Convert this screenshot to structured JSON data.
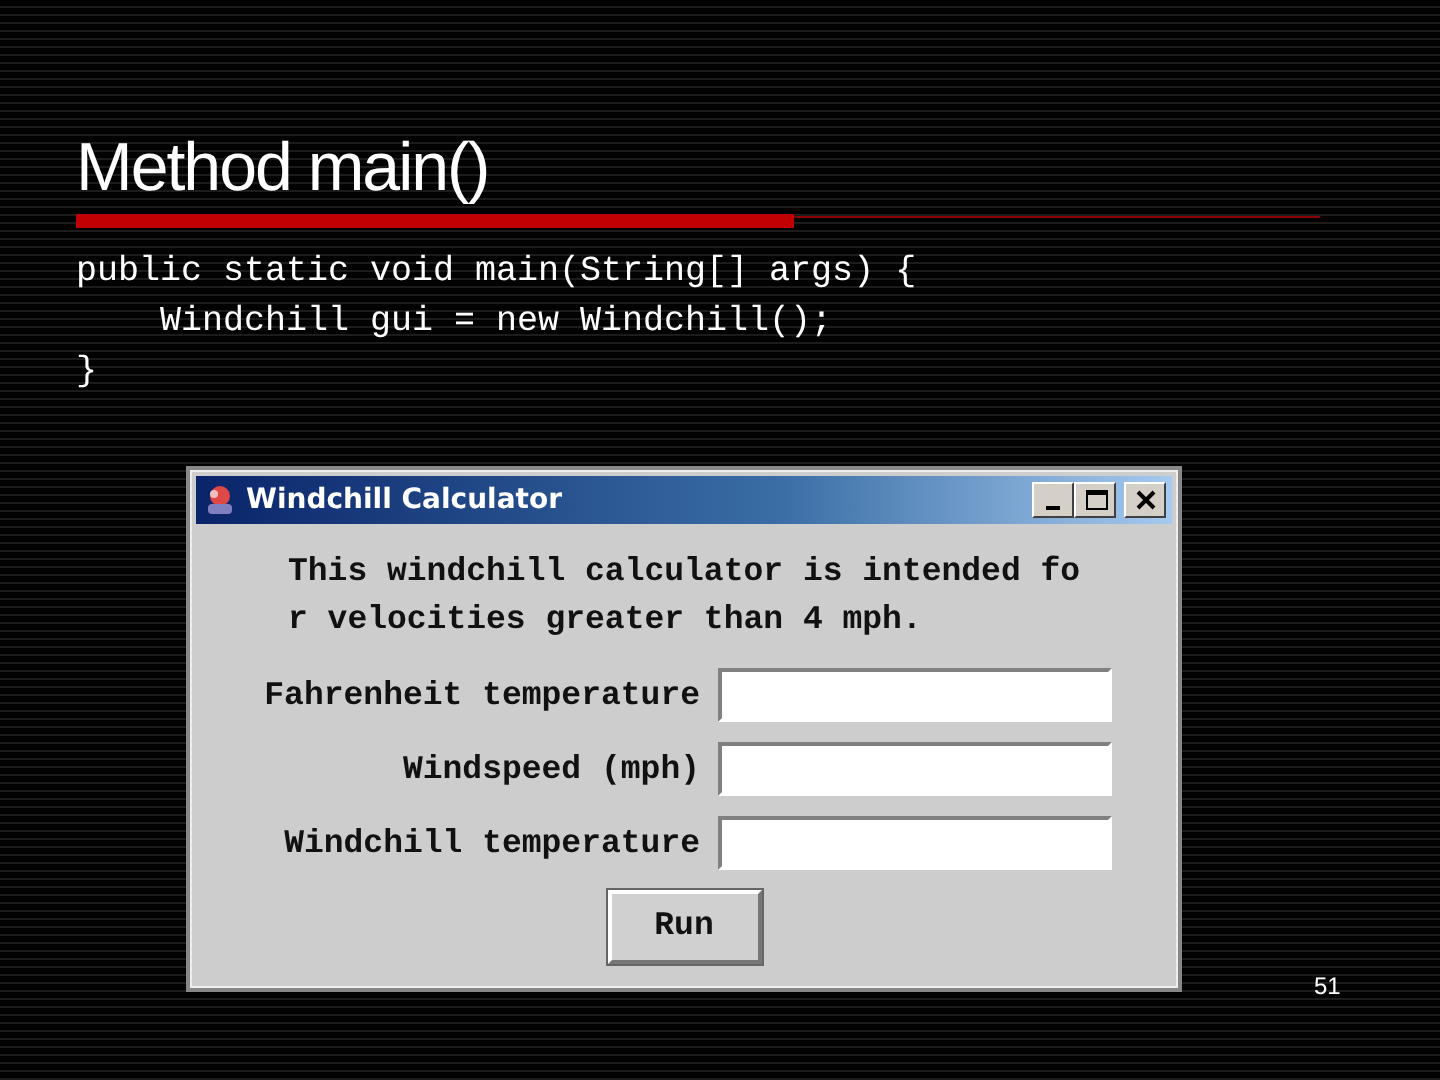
{
  "slide": {
    "title": "Method main()",
    "code_lines": [
      "public static void main(String[] args) {",
      "    Windchill gui = new Windchill();",
      "}"
    ],
    "page_number": "51"
  },
  "window": {
    "title": "Windchill Calculator",
    "description_lines": [
      "This windchill calculator is intended fo",
      "r velocities greater than 4 mph."
    ],
    "fields": [
      {
        "label": "Fahrenheit temperature"
      },
      {
        "label": "Windspeed (mph)"
      },
      {
        "label": "Windchill temperature"
      }
    ],
    "run_button": "Run"
  }
}
